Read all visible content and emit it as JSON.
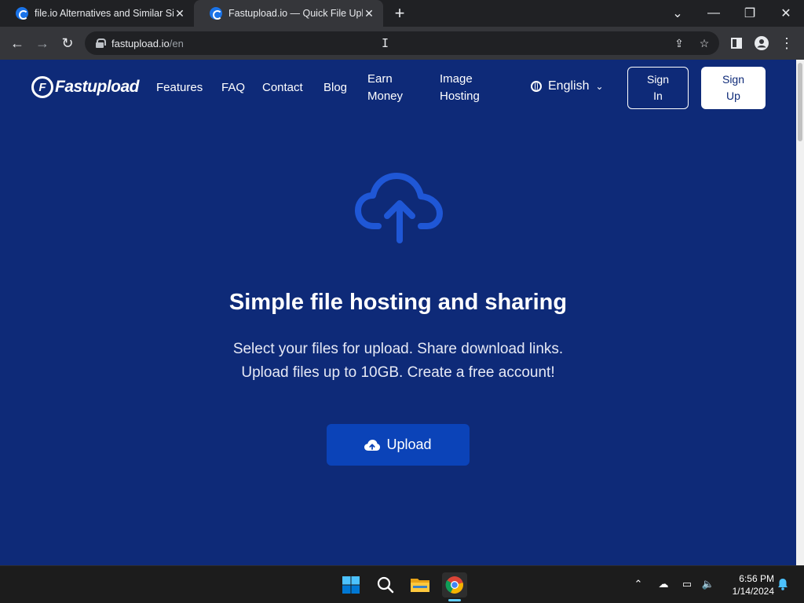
{
  "browser": {
    "tabs": [
      {
        "title": "file.io Alternatives and Similar Sit"
      },
      {
        "title": "Fastupload.io — Quick File Uploa"
      }
    ],
    "url_host": "fastupload.io",
    "url_path": "/en"
  },
  "site": {
    "brand": "Fastupload",
    "nav": {
      "features": "Features",
      "faq": "FAQ",
      "contact": "Contact",
      "blog": "Blog",
      "earn_1": "Earn",
      "earn_2": "Money",
      "image_1": "Image",
      "image_2": "Hosting"
    },
    "language": "English",
    "sign_in_1": "Sign",
    "sign_in_2": "In",
    "sign_up_1": "Sign",
    "sign_up_2": "Up"
  },
  "hero": {
    "title": "Simple file hosting and sharing",
    "line1": "Select your files for upload. Share download links.",
    "line2": "Upload files up to 10GB. Create a free account!",
    "upload_label": "Upload"
  },
  "taskbar": {
    "time": "6:56 PM",
    "date": "1/14/2024"
  },
  "colors": {
    "page_bg": "#0e2a78",
    "upload_button": "#0b43b8",
    "cloud_icon": "#1f57d6"
  }
}
